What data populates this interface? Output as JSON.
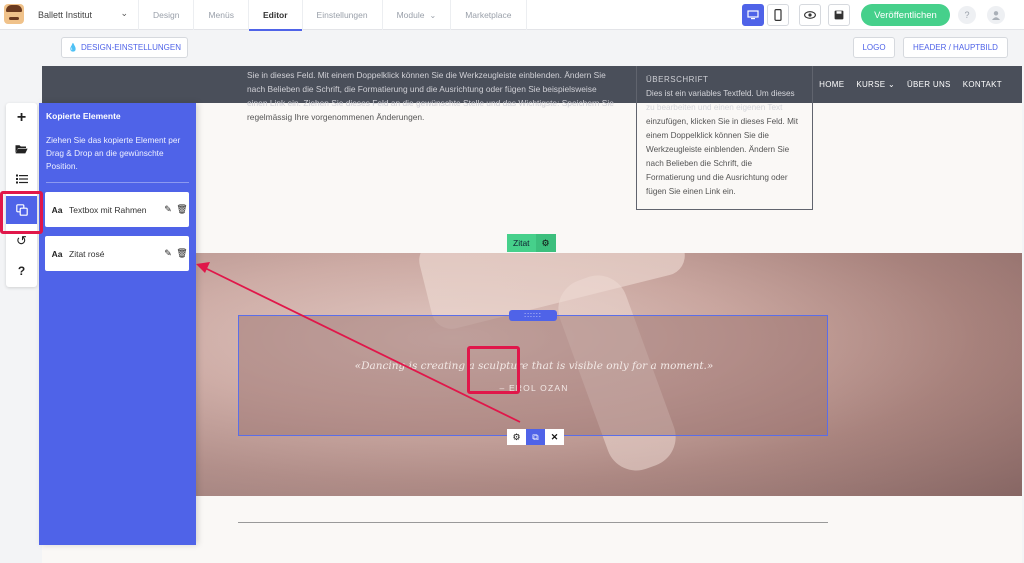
{
  "app": {
    "site_name": "Ballett Institut",
    "nav_tabs": [
      {
        "label": "Design",
        "dropdown": false
      },
      {
        "label": "Menüs",
        "dropdown": false
      },
      {
        "label": "Editor",
        "dropdown": false,
        "active": true
      },
      {
        "label": "Einstellungen",
        "dropdown": false
      },
      {
        "label": "Module",
        "dropdown": true
      },
      {
        "label": "Marketplace",
        "dropdown": false
      }
    ],
    "publish_label": "Veröffentlichen",
    "help_label": "?",
    "device_mode": "desktop"
  },
  "subbar": {
    "design_settings_label": "DESIGN-EINSTELLUNGEN",
    "logo_label": "LOGO",
    "header_label": "HEADER / HAUPTBILD"
  },
  "site": {
    "nav": [
      "HOME",
      "KURSE",
      "ÜBER UNS",
      "KONTAKT"
    ],
    "nav_dropdown_item": "KURSE",
    "body_lines": [
      "Sie in dieses Feld. Mit einem Doppelklick können Sie die Werkzeugleiste einblenden. Ändern Sie",
      "nach Belieben die Schrift, die Formatierung und die Ausrichtung oder fügen Sie beispielsweise",
      "einen Link ein. Ziehen Sie dieses Feld an die gewünschte Stelle und das Wichtigste: Speichern Sie",
      "regelmässig Ihre vorgenommenen Änderungen."
    ],
    "box_heading": "ÜBERSCHRIFT",
    "box_lines": [
      "Dies ist ein variables Textfeld. Um dieses",
      "zu bearbeiten und einen eigenen Text",
      "einzufügen, klicken Sie in dieses Feld. Mit",
      "einem Doppelklick können Sie die",
      "Werkzeugleiste einblenden. Ändern Sie",
      "nach Belieben die Schrift, die",
      "Formatierung und die Ausrichtung oder",
      "fügen Sie einen Link ein."
    ],
    "section_tag": "Zitat",
    "quote_text": "«Dancing is creating a sculpture that is visible only for a moment.»",
    "quote_author": "– EROL OZAN",
    "drag_handle": "::::::"
  },
  "toolbar": {
    "buttons": [
      {
        "icon": "plus-icon",
        "glyph": "+"
      },
      {
        "icon": "folder-icon",
        "glyph": "📂"
      },
      {
        "icon": "list-icon",
        "glyph": "☰"
      },
      {
        "icon": "copy-icon",
        "glyph": "⧉",
        "active": true
      },
      {
        "icon": "history-icon",
        "glyph": "↺"
      },
      {
        "icon": "help-icon",
        "glyph": "?"
      }
    ]
  },
  "panel": {
    "title": "Kopierte Elemente",
    "description": "Ziehen Sie das kopierte Element per Drag & Drop an die gewünschte Position.",
    "items": [
      {
        "type_label": "Aa",
        "name": "Textbox mit Rahmen"
      },
      {
        "type_label": "Aa",
        "name": "Zitat rosé"
      }
    ]
  },
  "colors": {
    "accent": "#4f63e8",
    "publish": "#46d08b",
    "highlight": "#e0174a",
    "site_header": "#4a4f5a"
  }
}
